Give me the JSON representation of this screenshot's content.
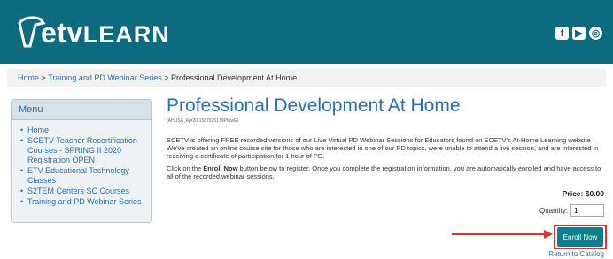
{
  "header": {
    "logo_text_etv": "etv",
    "logo_text_learn": "LEARN",
    "social_icons": [
      "facebook-icon",
      "youtube-icon",
      "globe-icon"
    ]
  },
  "breadcrumb": {
    "items": [
      "Home",
      "Training and PD Webinar Series",
      "Professional Development At Home"
    ]
  },
  "menu": {
    "title": "Menu",
    "items": [
      "Home",
      "SCETV Teacher Recertification Courses - SPRING II 2020 Registration OPEN",
      "ETV Educational Technology Classes",
      "S2TEM Centers SC Courses",
      "Training and PD Webinar Series"
    ]
  },
  "main": {
    "title": "Professional Development At Home",
    "course_code": "(AHUSA_Apr20-1587925179PWwE)",
    "paragraph1": "SCETV is offering FREE recorded versions of our Live Virtual PD Webinar Sessions for Educators found on SCETV's At-Home Learning website We've created an online course site for those who are interested in one of our PD topics, were unable to attend a live session, and are interested in receiving a certificate of participation for 1 hour of PD.",
    "paragraph2_prefix": "Click on the ",
    "paragraph2_bold": "Enroll Now",
    "paragraph2_suffix": " button below to register. Once you complete the registration information, you are automatically enrolled and have access to all of the recorded webinar sessions.",
    "price_label": "Price: $0.00",
    "quantity_label": "Quantity:",
    "quantity_value": "1",
    "enroll_label": "Enroll Now",
    "return_label": "Return to Catalog"
  }
}
